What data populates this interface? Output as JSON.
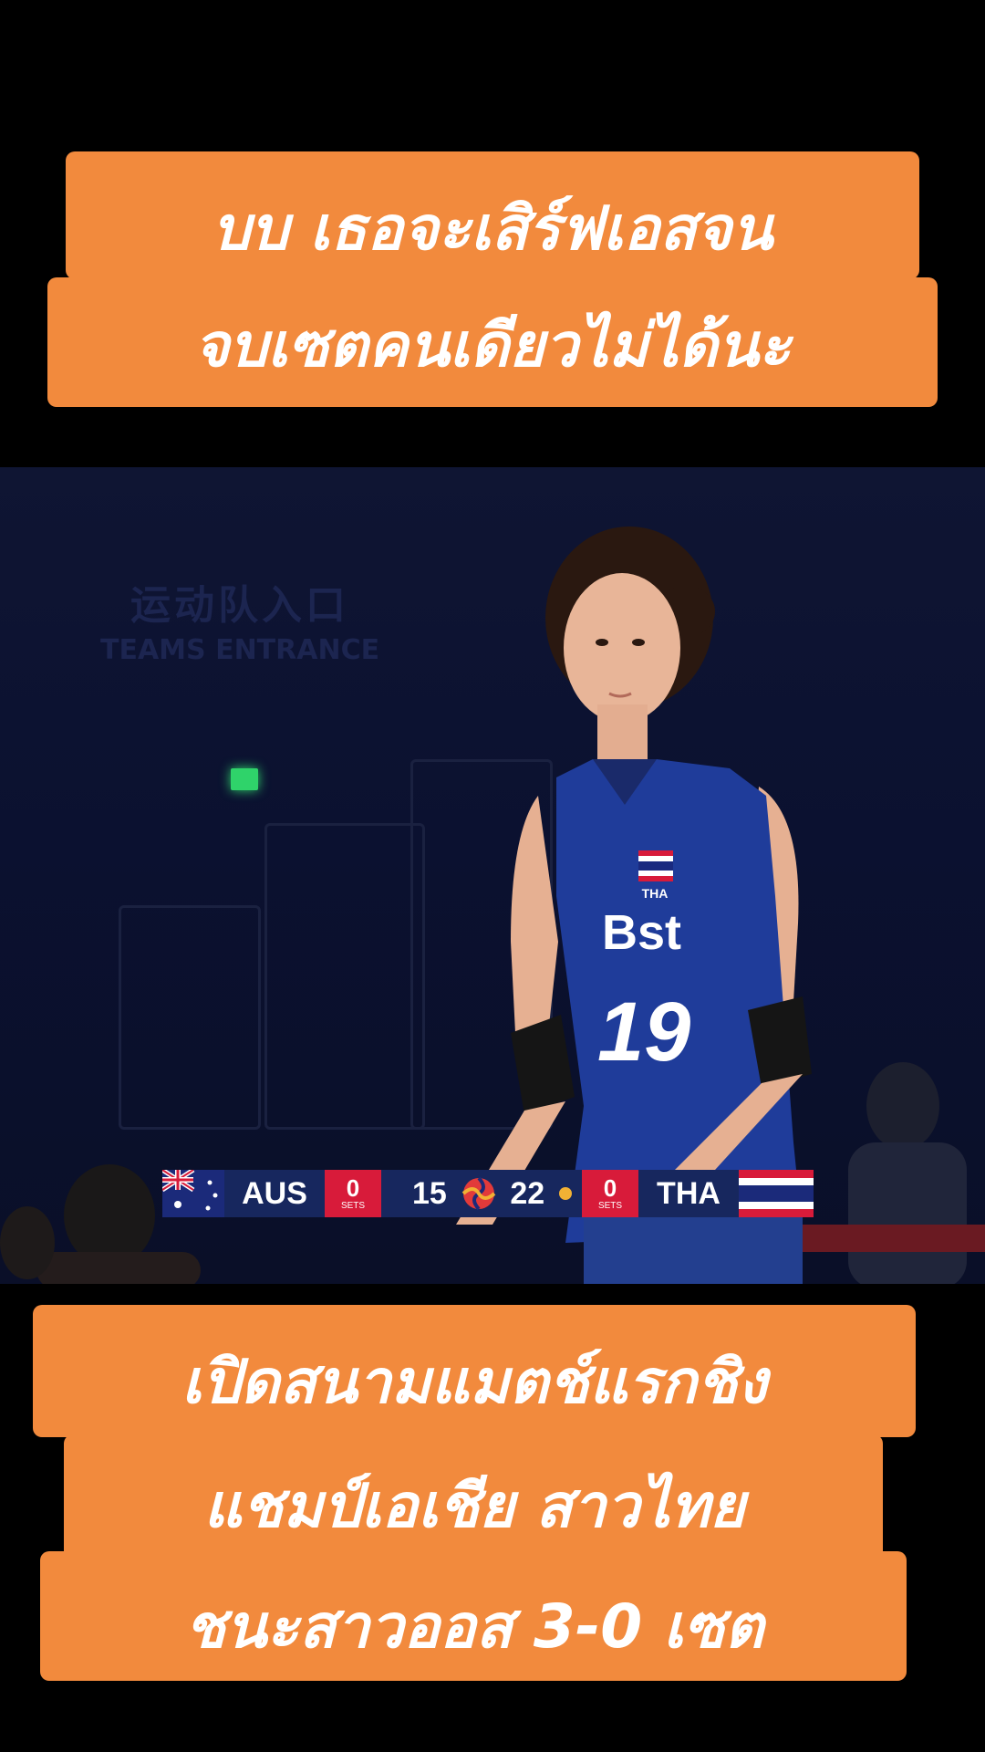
{
  "captions": {
    "top": [
      "บบ เธอจะเสิร์ฟเอสจน",
      "จบเซตคนเดียวไม่ได้นะ"
    ],
    "bottom": [
      "เปิดสนามแมตช์แรกชิง",
      "แชมป์เอเชีย สาวไทย",
      "ชนะสาวออส 3-0 เซต"
    ]
  },
  "background_signs": {
    "chinese": "运动队入口",
    "english": "TEAMS ENTRANCE"
  },
  "jersey": {
    "brand": "Bst",
    "country": "THA",
    "number": "19"
  },
  "scoreboard": {
    "home_team": "AUS",
    "home_sets": "0",
    "home_points": "15",
    "away_points": "22",
    "away_sets": "0",
    "away_team": "THA",
    "sets_label": "SETS"
  },
  "colors": {
    "caption_bg": "#f28a3d",
    "scoreboard_bg": "#17275e",
    "sets_bg": "#d81b3a",
    "jersey_blue": "#1f3c9a"
  },
  "icons": [
    "australia-flag-icon",
    "volleyball-icon",
    "serve-ball-icon",
    "thailand-flag-icon"
  ]
}
